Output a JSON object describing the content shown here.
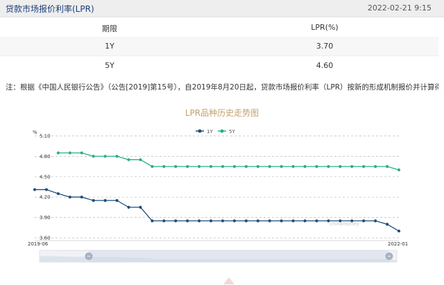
{
  "header": {
    "title": "贷款市场报价利率(LPR)",
    "datetime": "2022-02-21 9:15"
  },
  "table": {
    "columns": [
      "期限",
      "LPR(%)"
    ],
    "rows": [
      {
        "term": "1Y",
        "rate": "3.70"
      },
      {
        "term": "5Y",
        "rate": "4.60"
      }
    ]
  },
  "note": "注：根据《中国人民银行公告》（公告[2019]第15号），自2019年8月20日起，贷款市场报价利率（LPR）按新的形成机制报价并计算得出。",
  "colors": {
    "series_1y": "#1f4e79",
    "series_5y": "#2ab07f",
    "title_gold": "#c4a06a",
    "header_blue": "#1a3c7a"
  },
  "chart_data": {
    "type": "line",
    "title": "LPR品种历史走势图",
    "ylabel": "%",
    "ylim": [
      3.6,
      5.1
    ],
    "yticks": [
      "5.10",
      "4.80",
      "4.50",
      "4.20",
      "3.90",
      "3.60"
    ],
    "x_start_label": "2019-06",
    "x_end_label": "2022-01",
    "grid": true,
    "legend_position": "top-center",
    "watermark": "chinamoney",
    "series": [
      {
        "name": "1Y",
        "values": [
          4.31,
          4.31,
          4.25,
          4.2,
          4.2,
          4.15,
          4.15,
          4.15,
          4.05,
          4.05,
          3.85,
          3.85,
          3.85,
          3.85,
          3.85,
          3.85,
          3.85,
          3.85,
          3.85,
          3.85,
          3.85,
          3.85,
          3.85,
          3.85,
          3.85,
          3.85,
          3.85,
          3.85,
          3.85,
          3.85,
          3.8,
          3.7
        ]
      },
      {
        "name": "5Y",
        "values": [
          null,
          null,
          4.85,
          4.85,
          4.85,
          4.8,
          4.8,
          4.8,
          4.75,
          4.75,
          4.65,
          4.65,
          4.65,
          4.65,
          4.65,
          4.65,
          4.65,
          4.65,
          4.65,
          4.65,
          4.65,
          4.65,
          4.65,
          4.65,
          4.65,
          4.65,
          4.65,
          4.65,
          4.65,
          4.65,
          4.65,
          4.6
        ]
      }
    ]
  }
}
